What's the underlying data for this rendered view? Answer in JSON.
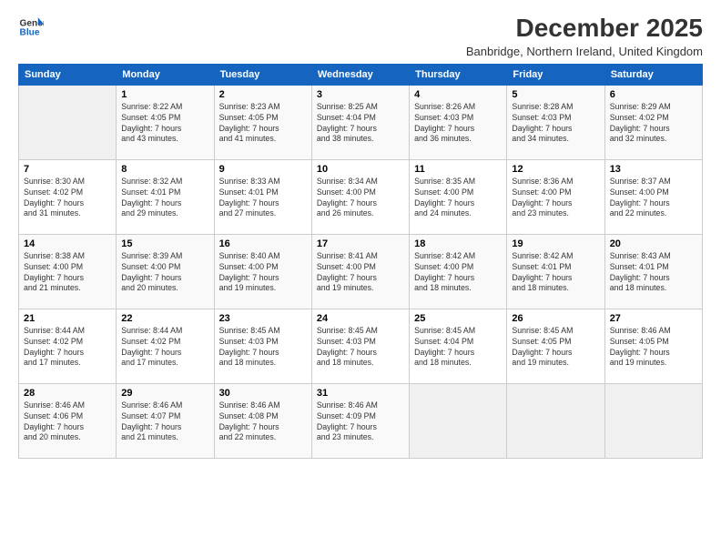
{
  "logo": {
    "line1": "General",
    "line2": "Blue"
  },
  "title": "December 2025",
  "subtitle": "Banbridge, Northern Ireland, United Kingdom",
  "days_header": [
    "Sunday",
    "Monday",
    "Tuesday",
    "Wednesday",
    "Thursday",
    "Friday",
    "Saturday"
  ],
  "weeks": [
    [
      {
        "num": "",
        "info": ""
      },
      {
        "num": "1",
        "info": "Sunrise: 8:22 AM\nSunset: 4:05 PM\nDaylight: 7 hours\nand 43 minutes."
      },
      {
        "num": "2",
        "info": "Sunrise: 8:23 AM\nSunset: 4:05 PM\nDaylight: 7 hours\nand 41 minutes."
      },
      {
        "num": "3",
        "info": "Sunrise: 8:25 AM\nSunset: 4:04 PM\nDaylight: 7 hours\nand 38 minutes."
      },
      {
        "num": "4",
        "info": "Sunrise: 8:26 AM\nSunset: 4:03 PM\nDaylight: 7 hours\nand 36 minutes."
      },
      {
        "num": "5",
        "info": "Sunrise: 8:28 AM\nSunset: 4:03 PM\nDaylight: 7 hours\nand 34 minutes."
      },
      {
        "num": "6",
        "info": "Sunrise: 8:29 AM\nSunset: 4:02 PM\nDaylight: 7 hours\nand 32 minutes."
      }
    ],
    [
      {
        "num": "7",
        "info": "Sunrise: 8:30 AM\nSunset: 4:02 PM\nDaylight: 7 hours\nand 31 minutes."
      },
      {
        "num": "8",
        "info": "Sunrise: 8:32 AM\nSunset: 4:01 PM\nDaylight: 7 hours\nand 29 minutes."
      },
      {
        "num": "9",
        "info": "Sunrise: 8:33 AM\nSunset: 4:01 PM\nDaylight: 7 hours\nand 27 minutes."
      },
      {
        "num": "10",
        "info": "Sunrise: 8:34 AM\nSunset: 4:00 PM\nDaylight: 7 hours\nand 26 minutes."
      },
      {
        "num": "11",
        "info": "Sunrise: 8:35 AM\nSunset: 4:00 PM\nDaylight: 7 hours\nand 24 minutes."
      },
      {
        "num": "12",
        "info": "Sunrise: 8:36 AM\nSunset: 4:00 PM\nDaylight: 7 hours\nand 23 minutes."
      },
      {
        "num": "13",
        "info": "Sunrise: 8:37 AM\nSunset: 4:00 PM\nDaylight: 7 hours\nand 22 minutes."
      }
    ],
    [
      {
        "num": "14",
        "info": "Sunrise: 8:38 AM\nSunset: 4:00 PM\nDaylight: 7 hours\nand 21 minutes."
      },
      {
        "num": "15",
        "info": "Sunrise: 8:39 AM\nSunset: 4:00 PM\nDaylight: 7 hours\nand 20 minutes."
      },
      {
        "num": "16",
        "info": "Sunrise: 8:40 AM\nSunset: 4:00 PM\nDaylight: 7 hours\nand 19 minutes."
      },
      {
        "num": "17",
        "info": "Sunrise: 8:41 AM\nSunset: 4:00 PM\nDaylight: 7 hours\nand 19 minutes."
      },
      {
        "num": "18",
        "info": "Sunrise: 8:42 AM\nSunset: 4:00 PM\nDaylight: 7 hours\nand 18 minutes."
      },
      {
        "num": "19",
        "info": "Sunrise: 8:42 AM\nSunset: 4:01 PM\nDaylight: 7 hours\nand 18 minutes."
      },
      {
        "num": "20",
        "info": "Sunrise: 8:43 AM\nSunset: 4:01 PM\nDaylight: 7 hours\nand 18 minutes."
      }
    ],
    [
      {
        "num": "21",
        "info": "Sunrise: 8:44 AM\nSunset: 4:02 PM\nDaylight: 7 hours\nand 17 minutes."
      },
      {
        "num": "22",
        "info": "Sunrise: 8:44 AM\nSunset: 4:02 PM\nDaylight: 7 hours\nand 17 minutes."
      },
      {
        "num": "23",
        "info": "Sunrise: 8:45 AM\nSunset: 4:03 PM\nDaylight: 7 hours\nand 18 minutes."
      },
      {
        "num": "24",
        "info": "Sunrise: 8:45 AM\nSunset: 4:03 PM\nDaylight: 7 hours\nand 18 minutes."
      },
      {
        "num": "25",
        "info": "Sunrise: 8:45 AM\nSunset: 4:04 PM\nDaylight: 7 hours\nand 18 minutes."
      },
      {
        "num": "26",
        "info": "Sunrise: 8:45 AM\nSunset: 4:05 PM\nDaylight: 7 hours\nand 19 minutes."
      },
      {
        "num": "27",
        "info": "Sunrise: 8:46 AM\nSunset: 4:05 PM\nDaylight: 7 hours\nand 19 minutes."
      }
    ],
    [
      {
        "num": "28",
        "info": "Sunrise: 8:46 AM\nSunset: 4:06 PM\nDaylight: 7 hours\nand 20 minutes."
      },
      {
        "num": "29",
        "info": "Sunrise: 8:46 AM\nSunset: 4:07 PM\nDaylight: 7 hours\nand 21 minutes."
      },
      {
        "num": "30",
        "info": "Sunrise: 8:46 AM\nSunset: 4:08 PM\nDaylight: 7 hours\nand 22 minutes."
      },
      {
        "num": "31",
        "info": "Sunrise: 8:46 AM\nSunset: 4:09 PM\nDaylight: 7 hours\nand 23 minutes."
      },
      {
        "num": "",
        "info": ""
      },
      {
        "num": "",
        "info": ""
      },
      {
        "num": "",
        "info": ""
      }
    ]
  ]
}
